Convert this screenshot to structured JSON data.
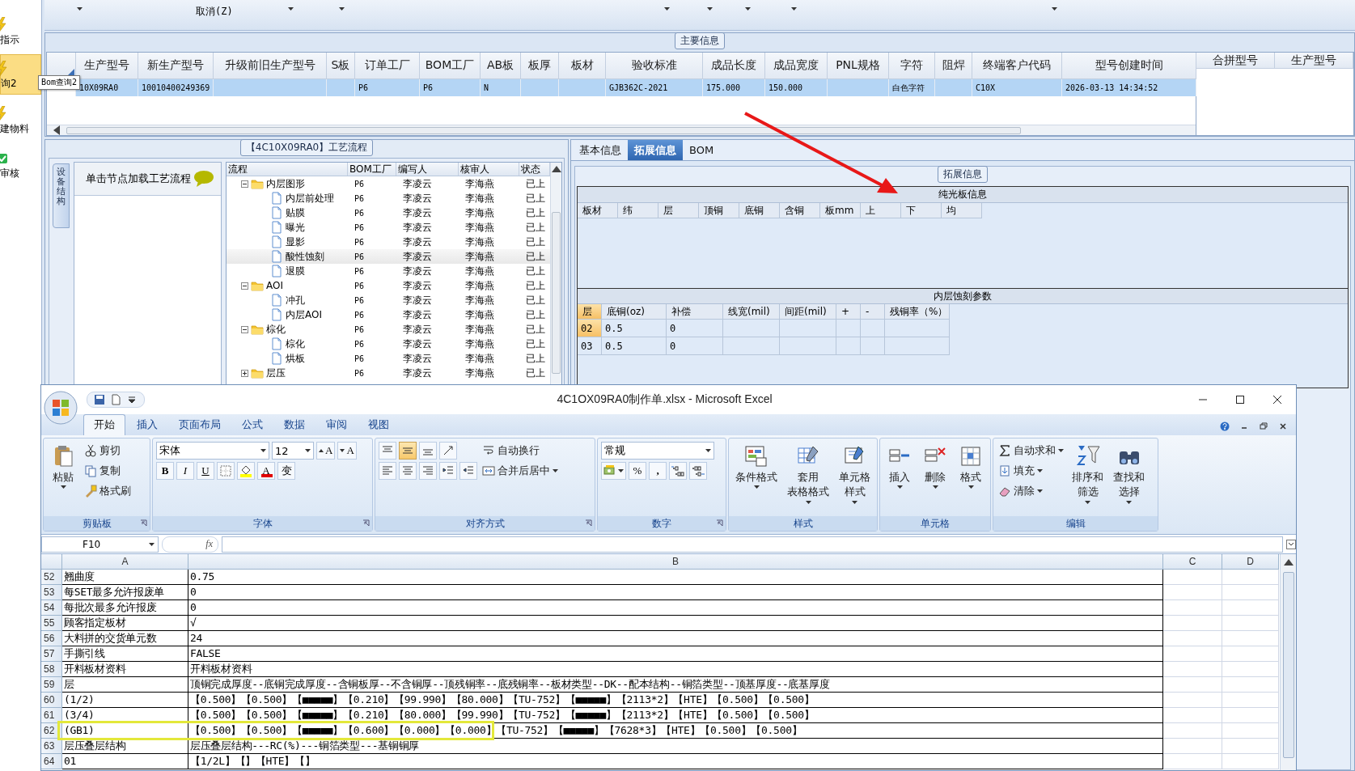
{
  "sidebar": {
    "items": [
      {
        "label": "指示",
        "kind": "bolt",
        "selected": false
      },
      {
        "label": "询2",
        "kind": "bolt",
        "selected": true
      },
      {
        "label": "建物料",
        "kind": "bolt",
        "selected": false
      },
      {
        "label": "审核",
        "kind": "check",
        "selected": false
      }
    ],
    "tooltip": "Bom查询2"
  },
  "toolbar": {
    "items": [
      "取消(Z)"
    ]
  },
  "main_info": {
    "title": "主要信息",
    "columns": [
      "生产型号",
      "新生产型号",
      "升级前旧生产型号",
      "S板",
      "订单工厂",
      "BOM工厂",
      "AB板",
      "板厚",
      "板材",
      "验收标准",
      "成品长度",
      "成品宽度",
      "PNL规格",
      "字符",
      "阻焊",
      "终端客户代码",
      "型号创建时间"
    ],
    "rows": [
      {
        "selected": true,
        "cells": [
          "10X09RA0",
          "10010400249369",
          "",
          "",
          "P6",
          "P6",
          "N",
          "",
          "",
          "GJB362C-2021",
          "175.000",
          "150.000",
          "",
          "白色字符",
          "",
          "C10X",
          "2026-03-13 14:34:52"
        ]
      }
    ],
    "side_columns": [
      "合拼型号",
      "生产型号"
    ]
  },
  "process": {
    "title": "【4C10X09RA0】工艺流程",
    "side_tab": "设备结构",
    "hint": "单击节点加载工艺流程",
    "columns": [
      "流程",
      "BOM工厂",
      "编写人",
      "核审人",
      "状态"
    ],
    "tree": [
      {
        "kind": "folder",
        "label": "内层图形",
        "expanded": true,
        "selected": false,
        "cells": [
          "P6",
          "李凌云",
          "李海燕",
          "已上"
        ],
        "children": [
          {
            "kind": "step",
            "label": "内层前处理",
            "selected": false,
            "cells": [
              "P6",
              "李凌云",
              "李海燕",
              "已上"
            ]
          },
          {
            "kind": "step",
            "label": "贴膜",
            "selected": false,
            "cells": [
              "P6",
              "李凌云",
              "李海燕",
              "已上"
            ]
          },
          {
            "kind": "step",
            "label": "曝光",
            "selected": false,
            "cells": [
              "P6",
              "李凌云",
              "李海燕",
              "已上"
            ]
          },
          {
            "kind": "step",
            "label": "显影",
            "selected": false,
            "cells": [
              "P6",
              "李凌云",
              "李海燕",
              "已上"
            ]
          },
          {
            "kind": "step",
            "label": "酸性蚀刻",
            "selected": true,
            "cells": [
              "P6",
              "李凌云",
              "李海燕",
              "已上"
            ]
          },
          {
            "kind": "step",
            "label": "退膜",
            "selected": false,
            "cells": [
              "P6",
              "李凌云",
              "李海燕",
              "已上"
            ]
          }
        ]
      },
      {
        "kind": "folder",
        "label": "AOI",
        "expanded": true,
        "selected": false,
        "cells": [
          "P6",
          "李凌云",
          "李海燕",
          "已上"
        ],
        "children": [
          {
            "kind": "step",
            "label": "冲孔",
            "selected": false,
            "cells": [
              "P6",
              "李凌云",
              "李海燕",
              "已上"
            ]
          },
          {
            "kind": "step",
            "label": "内层AOI",
            "selected": false,
            "cells": [
              "P6",
              "李凌云",
              "李海燕",
              "已上"
            ]
          }
        ]
      },
      {
        "kind": "folder",
        "label": "棕化",
        "expanded": true,
        "selected": false,
        "cells": [
          "P6",
          "李凌云",
          "李海燕",
          "已上"
        ],
        "children": [
          {
            "kind": "step",
            "label": "棕化",
            "selected": false,
            "cells": [
              "P6",
              "李凌云",
              "李海燕",
              "已上"
            ]
          },
          {
            "kind": "step",
            "label": "烘板",
            "selected": false,
            "cells": [
              "P6",
              "李凌云",
              "李海燕",
              "已上"
            ]
          }
        ]
      },
      {
        "kind": "folder",
        "label": "层压",
        "expanded": false,
        "selected": false,
        "cells": [
          "P6",
          "李凌云",
          "李海燕",
          "已上"
        ]
      }
    ]
  },
  "detail": {
    "tabs": [
      {
        "label": "基本信息",
        "selected": false
      },
      {
        "label": "拓展信息",
        "selected": true
      },
      {
        "label": "BOM",
        "selected": false
      }
    ],
    "group_title": "拓展信息",
    "bare_board": {
      "title": "纯光板信息",
      "columns": [
        "板材",
        "纬",
        "层",
        "顶铜",
        "底铜",
        "含铜",
        "板mm",
        "上",
        "下",
        "均"
      ]
    },
    "etch": {
      "title": "内层蚀刻参数",
      "columns": [
        "层",
        "底铜(oz)",
        "补偿",
        "线宽(mil)",
        "间距(mil)",
        "+",
        "-",
        "残铜率（%）"
      ],
      "rows": [
        {
          "selected": true,
          "cells": [
            "02",
            "0.5",
            "0",
            "",
            "",
            "",
            "",
            ""
          ]
        },
        {
          "selected": false,
          "cells": [
            "03",
            "0.5",
            "0",
            "",
            "",
            "",
            "",
            ""
          ]
        }
      ]
    }
  },
  "excel": {
    "title": "4C1OX09RA0制作单.xlsx - Microsoft Excel",
    "tabs": [
      {
        "label": "开始",
        "selected": true
      },
      {
        "label": "插入",
        "selected": false
      },
      {
        "label": "页面布局",
        "selected": false
      },
      {
        "label": "公式",
        "selected": false
      },
      {
        "label": "数据",
        "selected": false
      },
      {
        "label": "审阅",
        "selected": false
      },
      {
        "label": "视图",
        "selected": false
      }
    ],
    "ribbon": [
      {
        "kind": "clipboard",
        "label": "剪贴板",
        "big": "粘贴",
        "items": [
          "剪切",
          "复制",
          "格式刷"
        ]
      },
      {
        "kind": "font",
        "label": "字体",
        "font": "宋体",
        "size": "12",
        "grow": "A",
        "shrink": "A",
        "bold": "B",
        "italic": "I",
        "underline": "U",
        "font_color_label": "A",
        "phonetic": "变"
      },
      {
        "kind": "align",
        "label": "对齐方式",
        "valign": [
          {
            "selected": false
          },
          {
            "selected": true
          },
          {
            "selected": false
          }
        ],
        "wrap": "自动换行",
        "merge": "合并后居中"
      },
      {
        "kind": "number",
        "label": "数字",
        "format": "常规",
        "percent": "%",
        "comma": ","
      },
      {
        "kind": "big",
        "label": "样式",
        "items": [
          [
            "条件格式"
          ],
          [
            "套用",
            "表格格式"
          ],
          [
            "单元格",
            "样式"
          ]
        ]
      },
      {
        "kind": "big",
        "label": "单元格",
        "items": [
          [
            "插入"
          ],
          [
            "删除"
          ],
          [
            "格式"
          ]
        ]
      },
      {
        "kind": "editing",
        "label": "编辑",
        "items": [
          "自动求和",
          "填充",
          "清除"
        ],
        "big": [
          [
            "排序和",
            "筛选"
          ],
          [
            "查找和",
            "选择"
          ]
        ]
      }
    ],
    "name_box": "F10",
    "fx": "fx",
    "columns": [
      "A",
      "B",
      "C",
      "D"
    ],
    "rows": [
      {
        "n": "52",
        "a": "翘曲度",
        "b": "0.75"
      },
      {
        "n": "53",
        "a": "每SET最多允许报废单",
        "b": "0"
      },
      {
        "n": "54",
        "a": "每批次最多允许报废",
        "b": "0"
      },
      {
        "n": "55",
        "a": "顾客指定板材",
        "b": "√"
      },
      {
        "n": "56",
        "a": "大料拼的交货单元数",
        "b": "24"
      },
      {
        "n": "57",
        "a": "手撕引线",
        "b": "FALSE"
      },
      {
        "n": "58",
        "a": "开料板材资料",
        "b": "开料板材资料"
      },
      {
        "n": "59",
        "a": "层",
        "b": "顶铜完成厚度--底铜完成厚度--含铜板厚--不含铜厚--顶残铜率--底残铜率--板材类型--DK--配本结构--铜箔类型--顶基厚度--底基厚度"
      },
      {
        "n": "60",
        "a": "(1/2)",
        "b": "【0.500】【0.500】【■■■■■】【0.210】【99.990】【80.000】【TU-752】【■■■■■】【2113*2】【HTE】【0.500】【0.500】"
      },
      {
        "n": "61",
        "a": "(3/4)",
        "b": "【0.500】【0.500】【■■■■■】【0.210】【80.000】【99.990】【TU-752】【■■■■■】【2113*2】【HTE】【0.500】【0.500】"
      },
      {
        "n": "62",
        "a": "(GB1)",
        "b": "【0.500】【0.500】【■■■■■】【0.600】【0.000】【0.000】【TU-752】【■■■■■】【7628*3】【HTE】【0.500】【0.500】"
      },
      {
        "n": "63",
        "a": "层压叠层结构",
        "b": "层压叠层结构---RC(%)---铜箔类型---基铜铜厚"
      },
      {
        "n": "64",
        "a": "01",
        "b": "【1/2L】【】【HTE】【】"
      }
    ]
  }
}
